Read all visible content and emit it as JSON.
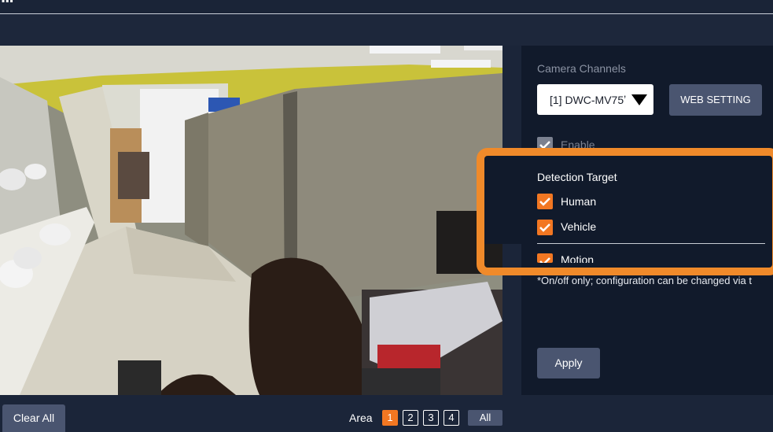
{
  "header": {
    "dots": "▪▪▪"
  },
  "camera_panel": {
    "channels_label": "Camera Channels",
    "channel_selected": "[1] DWC-MV75ʼ",
    "web_setting_label": "WEB SETTING",
    "enable_label": "Enable",
    "detection_target_label": "Detection Target",
    "human_label": "Human",
    "vehicle_label": "Vehicle",
    "motion_label": "Motion",
    "note": "*On/off only; configuration can be changed via t",
    "apply_label": "Apply"
  },
  "bottom_bar": {
    "clear_all_label": "Clear All",
    "area_label": "Area",
    "areas": [
      "1",
      "2",
      "3",
      "4"
    ],
    "active_area": "1",
    "all_label": "All"
  },
  "colors": {
    "accent": "#f27722",
    "highlight": "#f08a2a",
    "button": "#4a5570",
    "panel": "#111a2b",
    "background": "#1b2539"
  }
}
